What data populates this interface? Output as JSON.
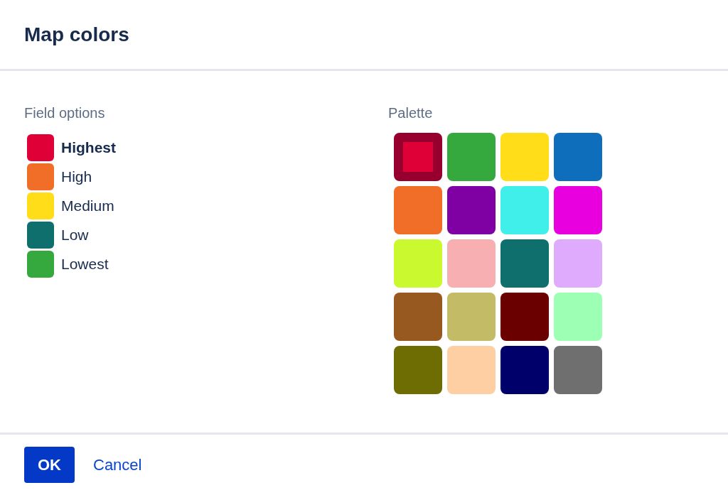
{
  "title": "Map colors",
  "field_options": {
    "heading": "Field options",
    "items": [
      {
        "label": "Highest",
        "color": "#de0037",
        "selected": true
      },
      {
        "label": "High",
        "color": "#f06e27",
        "selected": false
      },
      {
        "label": "Medium",
        "color": "#ffdd19",
        "selected": false
      },
      {
        "label": "Low",
        "color": "#0f6f6d",
        "selected": false
      },
      {
        "label": "Lowest",
        "color": "#36a93e",
        "selected": false
      }
    ]
  },
  "palette": {
    "heading": "Palette",
    "swatches": [
      {
        "color": "#de0037",
        "selected": true
      },
      {
        "color": "#36a93e",
        "selected": false
      },
      {
        "color": "#ffdd19",
        "selected": false
      },
      {
        "color": "#0f6ebc",
        "selected": false
      },
      {
        "color": "#f06e27",
        "selected": false
      },
      {
        "color": "#7f00a3",
        "selected": false
      },
      {
        "color": "#40eeea",
        "selected": false
      },
      {
        "color": "#e800df",
        "selected": false
      },
      {
        "color": "#cbf92f",
        "selected": false
      },
      {
        "color": "#f7afb2",
        "selected": false
      },
      {
        "color": "#0f6f6d",
        "selected": false
      },
      {
        "color": "#dfacfd",
        "selected": false
      },
      {
        "color": "#975920",
        "selected": false
      },
      {
        "color": "#c3bb66",
        "selected": false
      },
      {
        "color": "#6b0000",
        "selected": false
      },
      {
        "color": "#9dffb3",
        "selected": false
      },
      {
        "color": "#6d6d04",
        "selected": false
      },
      {
        "color": "#fdcfa3",
        "selected": false
      },
      {
        "color": "#00006b",
        "selected": false
      },
      {
        "color": "#6f6f6f",
        "selected": false
      }
    ]
  },
  "buttons": [
    {
      "label": "OK",
      "kind": "primary"
    },
    {
      "label": "Cancel",
      "kind": "link"
    }
  ]
}
